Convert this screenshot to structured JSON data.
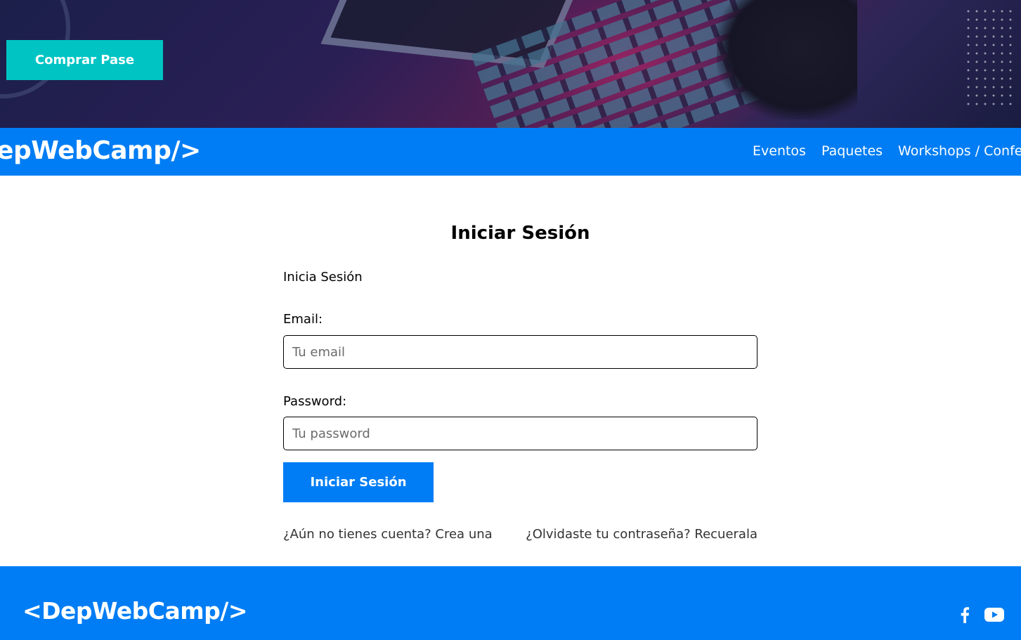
{
  "hero": {
    "buy_button_label": "Comprar Pase"
  },
  "navbar": {
    "logo": "<DepWebCamp/>",
    "links": [
      "Eventos",
      "Paquetes",
      "Workshops / Conferencias"
    ]
  },
  "form": {
    "title": "Iniciar Sesión",
    "subtitle": "Inicia Sesión",
    "email_label": "Email:",
    "email_placeholder": "Tu email",
    "password_label": "Password:",
    "password_placeholder": "Tu password",
    "submit_label": "Iniciar Sesión",
    "register_link": "¿Aún no tienes cuenta? Crea una",
    "forgot_link": "¿Olvidaste tu contraseña? Recuerala"
  },
  "footer": {
    "logo": "<DepWebCamp/>",
    "social_icons": [
      "facebook-icon",
      "youtube-icon"
    ]
  },
  "colors": {
    "primary": "#007df4",
    "accent": "#00c4c4"
  }
}
